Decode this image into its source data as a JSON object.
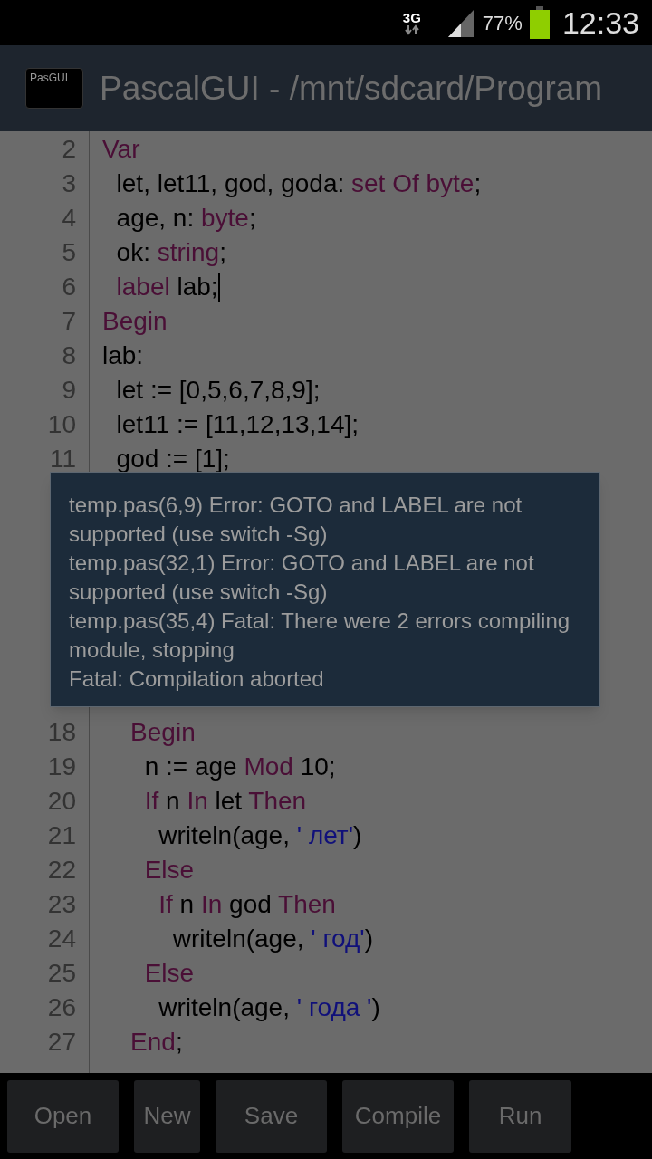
{
  "status_bar": {
    "network": "3G",
    "battery_text": "77%",
    "time": "12:33"
  },
  "app_bar": {
    "logo_text": "PasGUI",
    "title": "PascalGUI - /mnt/sdcard/Program"
  },
  "code_lines": [
    {
      "number": "2",
      "cursor": false,
      "tokens": [
        {
          "kind": "keyword",
          "text": "Var"
        }
      ]
    },
    {
      "number": "3",
      "cursor": false,
      "tokens": [
        {
          "kind": "plain",
          "text": "  let, let11, god, goda: "
        },
        {
          "kind": "keyword",
          "text": "set Of byte"
        },
        {
          "kind": "plain",
          "text": ";"
        }
      ]
    },
    {
      "number": "4",
      "cursor": false,
      "tokens": [
        {
          "kind": "plain",
          "text": "  age, n: "
        },
        {
          "kind": "keyword",
          "text": "byte"
        },
        {
          "kind": "plain",
          "text": ";"
        }
      ]
    },
    {
      "number": "5",
      "cursor": false,
      "tokens": [
        {
          "kind": "plain",
          "text": "  ok: "
        },
        {
          "kind": "keyword",
          "text": "string"
        },
        {
          "kind": "plain",
          "text": ";"
        }
      ]
    },
    {
      "number": "6",
      "cursor": true,
      "tokens": [
        {
          "kind": "keyword",
          "text": "  label"
        },
        {
          "kind": "plain",
          "text": " lab;"
        }
      ]
    },
    {
      "number": "7",
      "cursor": false,
      "tokens": [
        {
          "kind": "keyword",
          "text": "Begin"
        }
      ]
    },
    {
      "number": "8",
      "cursor": false,
      "tokens": [
        {
          "kind": "plain",
          "text": "lab:"
        }
      ]
    },
    {
      "number": "9",
      "cursor": false,
      "tokens": [
        {
          "kind": "plain",
          "text": "  let := [0,5,6,7,8,9];"
        }
      ]
    },
    {
      "number": "10",
      "cursor": false,
      "tokens": [
        {
          "kind": "plain",
          "text": "  let11 := [11,12,13,14];"
        }
      ]
    },
    {
      "number": "11",
      "cursor": false,
      "tokens": [
        {
          "kind": "plain",
          "text": "  god := [1];"
        }
      ]
    },
    {
      "number": "18",
      "cursor": false,
      "tokens": [
        {
          "kind": "keyword",
          "text": "    Begin"
        }
      ]
    },
    {
      "number": "19",
      "cursor": false,
      "tokens": [
        {
          "kind": "plain",
          "text": "      n := age "
        },
        {
          "kind": "keyword",
          "text": "Mod"
        },
        {
          "kind": "plain",
          "text": " 10;"
        }
      ]
    },
    {
      "number": "20",
      "cursor": false,
      "tokens": [
        {
          "kind": "keyword",
          "text": "      If"
        },
        {
          "kind": "plain",
          "text": " n "
        },
        {
          "kind": "keyword",
          "text": "In"
        },
        {
          "kind": "plain",
          "text": " let "
        },
        {
          "kind": "keyword",
          "text": "Then"
        }
      ]
    },
    {
      "number": "21",
      "cursor": false,
      "tokens": [
        {
          "kind": "plain",
          "text": "        writeln(age, "
        },
        {
          "kind": "string",
          "text": "' лет'"
        },
        {
          "kind": "plain",
          "text": ")"
        }
      ]
    },
    {
      "number": "22",
      "cursor": false,
      "tokens": [
        {
          "kind": "keyword",
          "text": "      Else"
        }
      ]
    },
    {
      "number": "23",
      "cursor": false,
      "tokens": [
        {
          "kind": "keyword",
          "text": "        If"
        },
        {
          "kind": "plain",
          "text": " n "
        },
        {
          "kind": "keyword",
          "text": "In"
        },
        {
          "kind": "plain",
          "text": " god "
        },
        {
          "kind": "keyword",
          "text": "Then"
        }
      ]
    },
    {
      "number": "24",
      "cursor": false,
      "tokens": [
        {
          "kind": "plain",
          "text": "          writeln(age, "
        },
        {
          "kind": "string",
          "text": "' год'"
        },
        {
          "kind": "plain",
          "text": ")"
        }
      ]
    },
    {
      "number": "25",
      "cursor": false,
      "tokens": [
        {
          "kind": "keyword",
          "text": "      Else"
        }
      ]
    },
    {
      "number": "26",
      "cursor": false,
      "tokens": [
        {
          "kind": "plain",
          "text": "        writeln(age, "
        },
        {
          "kind": "string",
          "text": "' года '"
        },
        {
          "kind": "plain",
          "text": ")"
        }
      ]
    },
    {
      "number": "27",
      "cursor": false,
      "tokens": [
        {
          "kind": "keyword",
          "text": "    End"
        },
        {
          "kind": "plain",
          "text": ";"
        }
      ]
    }
  ],
  "message": [
    "temp.pas(6,9) Error: GOTO and LABEL are not supported (use switch -Sg)",
    "temp.pas(32,1) Error: GOTO and LABEL are not supported (use switch -Sg)",
    "temp.pas(35,4) Fatal: There were 2 errors compiling module, stopping",
    "Fatal: Compilation aborted"
  ],
  "buttons": [
    "Open",
    "New",
    "Save",
    "Compile",
    "Run"
  ]
}
